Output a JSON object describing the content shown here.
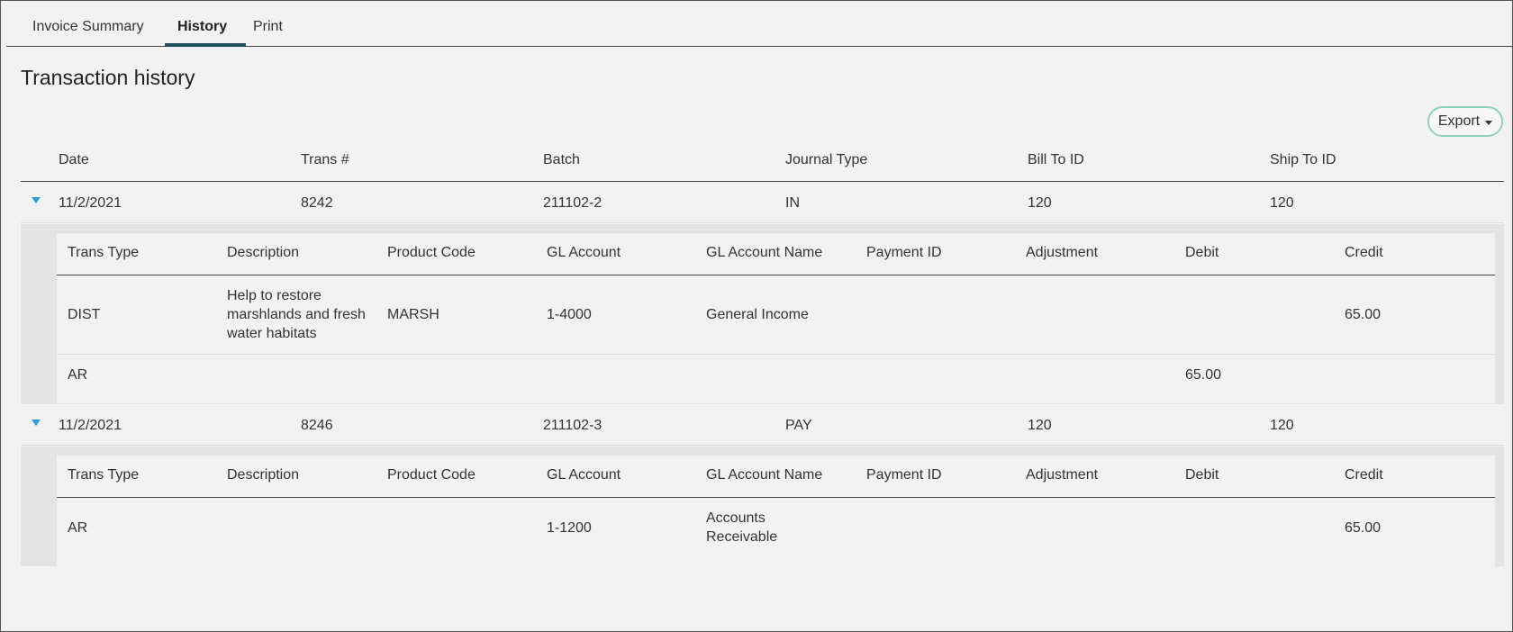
{
  "tabs": [
    {
      "label": "Invoice Summary"
    },
    {
      "label": "History"
    },
    {
      "label": "Print"
    }
  ],
  "page_title": "Transaction history",
  "export_label": "Export",
  "columns": [
    "Date",
    "Trans #",
    "Batch",
    "Journal Type",
    "Bill To ID",
    "Ship To ID"
  ],
  "detail_columns": [
    "Trans Type",
    "Description",
    "Product Code",
    "GL Account",
    "GL Account Name",
    "Payment ID",
    "Adjustment",
    "Debit",
    "Credit"
  ],
  "transactions": [
    {
      "date": "11/2/2021",
      "trans": "8242",
      "batch": "211102-2",
      "journal_type": "IN",
      "bill_to": "120",
      "ship_to": "120",
      "lines": [
        {
          "trans_type": "DIST",
          "description": "Help to restore marshlands and fresh water habitats",
          "product_code": "MARSH",
          "gl_account": "1-4000",
          "gl_account_name": "General Income",
          "payment_id": "",
          "adjustment": "",
          "debit": "",
          "credit": "65.00"
        },
        {
          "trans_type": "AR",
          "description": "",
          "product_code": "",
          "gl_account": "",
          "gl_account_name": "",
          "payment_id": "",
          "adjustment": "",
          "debit": "65.00",
          "credit": ""
        }
      ]
    },
    {
      "date": "11/2/2021",
      "trans": "8246",
      "batch": "211102-3",
      "journal_type": "PAY",
      "bill_to": "120",
      "ship_to": "120",
      "lines": [
        {
          "trans_type": "AR",
          "description": "",
          "product_code": "",
          "gl_account": "1-1200",
          "gl_account_name": "Accounts Receivable",
          "payment_id": "",
          "adjustment": "",
          "debit": "",
          "credit": "65.00"
        }
      ]
    }
  ],
  "colors": {
    "accent": "#1f4e5f",
    "link": "#20708a",
    "expand": "#2a9dd8",
    "export_border": "#8fd3b6"
  },
  "icons": {
    "expand": "triangle-down-icon",
    "export_caret": "caret-down-icon"
  }
}
